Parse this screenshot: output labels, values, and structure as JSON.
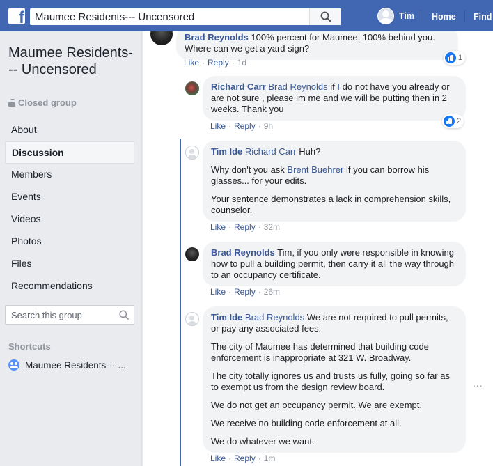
{
  "topbar": {
    "logo": "f",
    "search_query": "Maumee Residents--- Uncensored",
    "user_name": "Tim",
    "home_label": "Home",
    "find_label": "Find"
  },
  "group": {
    "title": "Maumee Residents--- Uncensored",
    "privacy": "Closed group"
  },
  "menu": [
    {
      "label": "About"
    },
    {
      "label": "Discussion",
      "active": true
    },
    {
      "label": "Members"
    },
    {
      "label": "Events"
    },
    {
      "label": "Videos"
    },
    {
      "label": "Photos"
    },
    {
      "label": "Files"
    },
    {
      "label": "Recommendations"
    }
  ],
  "group_search": {
    "placeholder": "Search this group"
  },
  "shortcuts": {
    "heading": "Shortcuts",
    "item": "Maumee Residents--- ..."
  },
  "actions": {
    "like": "Like",
    "reply": "Reply"
  },
  "comments": [
    {
      "author": "Brad Reynolds",
      "text": "100% percent for Maumee. 100% behind you. Where can we get a yard sign?",
      "time": "1d",
      "reactions": "1"
    },
    {
      "author": "Richard Carr",
      "mention": "Brad Reynolds",
      "text_before": "if ",
      "mention2": "I",
      "text": " do not have you already or are not sure , please im me and we will be putting then in 2 weeks. Thank you",
      "time": "9h",
      "reactions": "2"
    },
    {
      "author": "Tim Ide",
      "mention": "Richard Carr",
      "p1": "Huh?",
      "p2_before": "Why don't you ask ",
      "p2_mention": "Brent Buehrer",
      "p2_after": " if you can borrow his glasses... for your edits.",
      "p3": "Your sentence demonstrates a lack in comprehension skills, counselor.",
      "time": "32m"
    },
    {
      "author": "Brad Reynolds",
      "text": "Tim, if you only were responsible in knowing how to pull a building permit, then carry it all the way through to an occupancy certificate.",
      "time": "26m"
    },
    {
      "author": "Tim Ide",
      "mention": "Brad Reynolds",
      "p1": "We are not required to pull permits, or pay any associated fees.",
      "p2": "The city of Maumee has determined that building code enforcement is inappropriate at 321 W. Broadway.",
      "p3": "The city totally ignores us and trusts us fully, going so far as to exempt us from the design review board.",
      "p4": "We do not get an occupancy permit. We are exempt.",
      "p5": "We receive no building code enforcement at all.",
      "p6": "We do whatever we want.",
      "time": "1m"
    }
  ],
  "more_menu": "...",
  "colors": {
    "brand": "#4267b2",
    "link": "#385898",
    "bubble": "#f2f3f5",
    "like": "#1877f2"
  }
}
